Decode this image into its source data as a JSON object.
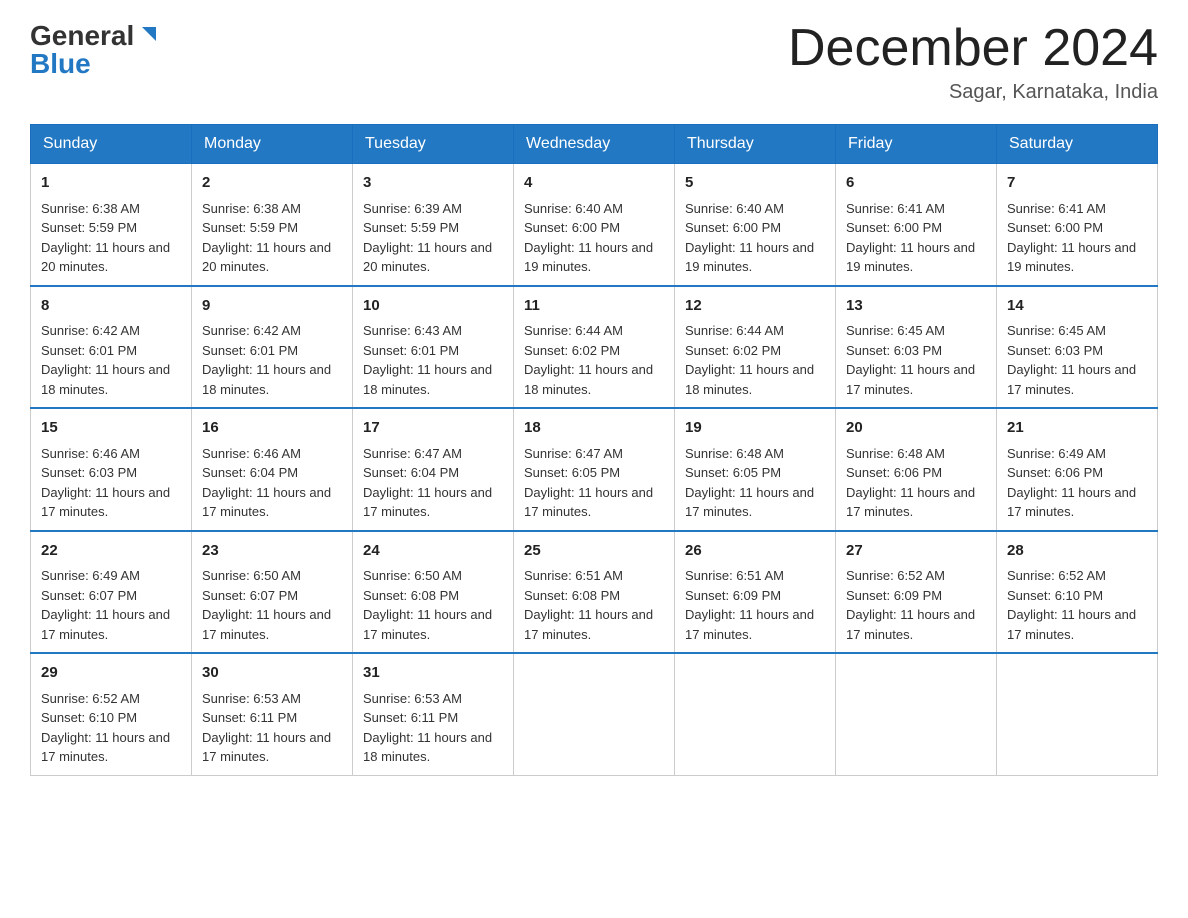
{
  "header": {
    "logo_general": "General",
    "logo_blue": "Blue",
    "month_title": "December 2024",
    "location": "Sagar, Karnataka, India"
  },
  "days_of_week": [
    "Sunday",
    "Monday",
    "Tuesday",
    "Wednesday",
    "Thursday",
    "Friday",
    "Saturday"
  ],
  "weeks": [
    [
      {
        "num": "1",
        "sunrise": "6:38 AM",
        "sunset": "5:59 PM",
        "daylight": "11 hours and 20 minutes."
      },
      {
        "num": "2",
        "sunrise": "6:38 AM",
        "sunset": "5:59 PM",
        "daylight": "11 hours and 20 minutes."
      },
      {
        "num": "3",
        "sunrise": "6:39 AM",
        "sunset": "5:59 PM",
        "daylight": "11 hours and 20 minutes."
      },
      {
        "num": "4",
        "sunrise": "6:40 AM",
        "sunset": "6:00 PM",
        "daylight": "11 hours and 19 minutes."
      },
      {
        "num": "5",
        "sunrise": "6:40 AM",
        "sunset": "6:00 PM",
        "daylight": "11 hours and 19 minutes."
      },
      {
        "num": "6",
        "sunrise": "6:41 AM",
        "sunset": "6:00 PM",
        "daylight": "11 hours and 19 minutes."
      },
      {
        "num": "7",
        "sunrise": "6:41 AM",
        "sunset": "6:00 PM",
        "daylight": "11 hours and 19 minutes."
      }
    ],
    [
      {
        "num": "8",
        "sunrise": "6:42 AM",
        "sunset": "6:01 PM",
        "daylight": "11 hours and 18 minutes."
      },
      {
        "num": "9",
        "sunrise": "6:42 AM",
        "sunset": "6:01 PM",
        "daylight": "11 hours and 18 minutes."
      },
      {
        "num": "10",
        "sunrise": "6:43 AM",
        "sunset": "6:01 PM",
        "daylight": "11 hours and 18 minutes."
      },
      {
        "num": "11",
        "sunrise": "6:44 AM",
        "sunset": "6:02 PM",
        "daylight": "11 hours and 18 minutes."
      },
      {
        "num": "12",
        "sunrise": "6:44 AM",
        "sunset": "6:02 PM",
        "daylight": "11 hours and 18 minutes."
      },
      {
        "num": "13",
        "sunrise": "6:45 AM",
        "sunset": "6:03 PM",
        "daylight": "11 hours and 17 minutes."
      },
      {
        "num": "14",
        "sunrise": "6:45 AM",
        "sunset": "6:03 PM",
        "daylight": "11 hours and 17 minutes."
      }
    ],
    [
      {
        "num": "15",
        "sunrise": "6:46 AM",
        "sunset": "6:03 PM",
        "daylight": "11 hours and 17 minutes."
      },
      {
        "num": "16",
        "sunrise": "6:46 AM",
        "sunset": "6:04 PM",
        "daylight": "11 hours and 17 minutes."
      },
      {
        "num": "17",
        "sunrise": "6:47 AM",
        "sunset": "6:04 PM",
        "daylight": "11 hours and 17 minutes."
      },
      {
        "num": "18",
        "sunrise": "6:47 AM",
        "sunset": "6:05 PM",
        "daylight": "11 hours and 17 minutes."
      },
      {
        "num": "19",
        "sunrise": "6:48 AM",
        "sunset": "6:05 PM",
        "daylight": "11 hours and 17 minutes."
      },
      {
        "num": "20",
        "sunrise": "6:48 AM",
        "sunset": "6:06 PM",
        "daylight": "11 hours and 17 minutes."
      },
      {
        "num": "21",
        "sunrise": "6:49 AM",
        "sunset": "6:06 PM",
        "daylight": "11 hours and 17 minutes."
      }
    ],
    [
      {
        "num": "22",
        "sunrise": "6:49 AM",
        "sunset": "6:07 PM",
        "daylight": "11 hours and 17 minutes."
      },
      {
        "num": "23",
        "sunrise": "6:50 AM",
        "sunset": "6:07 PM",
        "daylight": "11 hours and 17 minutes."
      },
      {
        "num": "24",
        "sunrise": "6:50 AM",
        "sunset": "6:08 PM",
        "daylight": "11 hours and 17 minutes."
      },
      {
        "num": "25",
        "sunrise": "6:51 AM",
        "sunset": "6:08 PM",
        "daylight": "11 hours and 17 minutes."
      },
      {
        "num": "26",
        "sunrise": "6:51 AM",
        "sunset": "6:09 PM",
        "daylight": "11 hours and 17 minutes."
      },
      {
        "num": "27",
        "sunrise": "6:52 AM",
        "sunset": "6:09 PM",
        "daylight": "11 hours and 17 minutes."
      },
      {
        "num": "28",
        "sunrise": "6:52 AM",
        "sunset": "6:10 PM",
        "daylight": "11 hours and 17 minutes."
      }
    ],
    [
      {
        "num": "29",
        "sunrise": "6:52 AM",
        "sunset": "6:10 PM",
        "daylight": "11 hours and 17 minutes."
      },
      {
        "num": "30",
        "sunrise": "6:53 AM",
        "sunset": "6:11 PM",
        "daylight": "11 hours and 17 minutes."
      },
      {
        "num": "31",
        "sunrise": "6:53 AM",
        "sunset": "6:11 PM",
        "daylight": "11 hours and 18 minutes."
      },
      null,
      null,
      null,
      null
    ]
  ]
}
